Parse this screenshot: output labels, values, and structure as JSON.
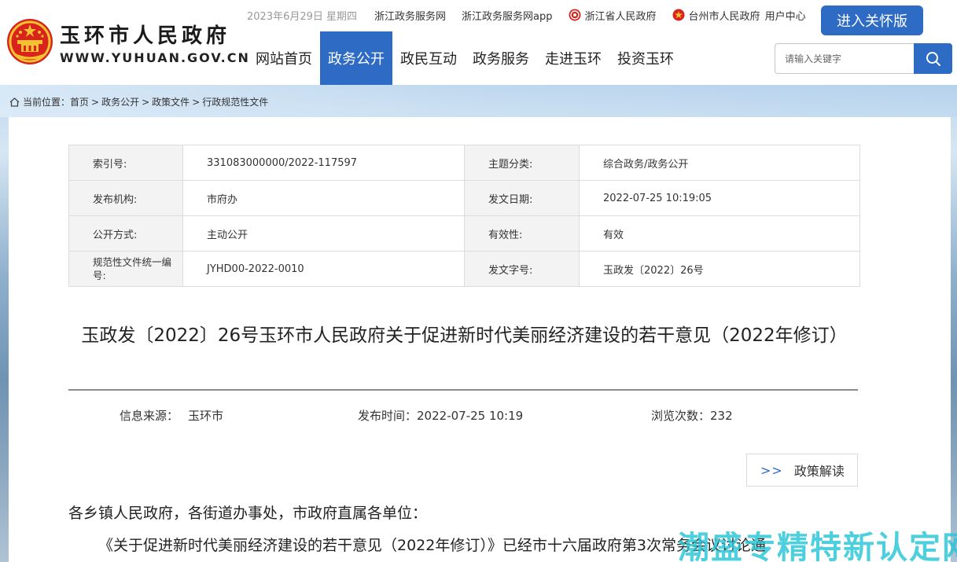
{
  "site": {
    "title": "玉环市人民政府",
    "url": "WWW.YUHUAN.GOV.CN",
    "date": "2023年6月29日 星期四",
    "top_links": [
      "浙江政务服务网",
      "浙江政务服务网app",
      "浙江省人民政府",
      "台州市人民政府",
      "用户中心"
    ],
    "care_button": "进入关怀版",
    "accent_color": "#2d6bc4"
  },
  "nav": {
    "items": [
      "网站首页",
      "政务公开",
      "政民互动",
      "政务服务",
      "走进玉环",
      "投资玉环"
    ],
    "active": "政务公开"
  },
  "search": {
    "placeholder": "请输入关键字",
    "value": ""
  },
  "breadcrumb": {
    "prefix": "当前位置：",
    "items": [
      "首页",
      "政务公开",
      "政策文件",
      "行政规范性文件"
    ]
  },
  "meta": {
    "rows": [
      {
        "k1": "索引号:",
        "v1": "331083000000/2022-117597",
        "k2": "主题分类:",
        "v2": "综合政务/政务公开"
      },
      {
        "k1": "发布机构:",
        "v1": "市府办",
        "k2": "发文日期:",
        "v2": "2022-07-25 10:19:05"
      },
      {
        "k1": "公开方式:",
        "v1": "主动公开",
        "k2": "有效性:",
        "v2": "有效"
      },
      {
        "k1": "规范性文件统一编号:",
        "v1": "JYHD00-2022-0010",
        "k2": "发文字号:",
        "v2": "玉政发〔2022〕26号"
      }
    ]
  },
  "document": {
    "title": "玉政发〔2022〕26号玉环市人民政府关于促进新时代美丽经济建设的若干意见（2022年修订）",
    "source_label": "信息来源：",
    "source": "玉环市",
    "time_label": "发布时间：",
    "time": "2022-07-25 10:19",
    "views_label": "浏览次数：",
    "views": "232",
    "policy_button": "政策解读",
    "policy_arrow": ">>",
    "body": [
      "各乡镇人民政府，各街道办事处，市政府直属各单位：",
      "《关于促进新时代美丽经济建设的若干意见（2022年修订）》已经市十六届政府第3次常务会议讨论通"
    ]
  },
  "watermark": "潮盛专精特新认定网"
}
